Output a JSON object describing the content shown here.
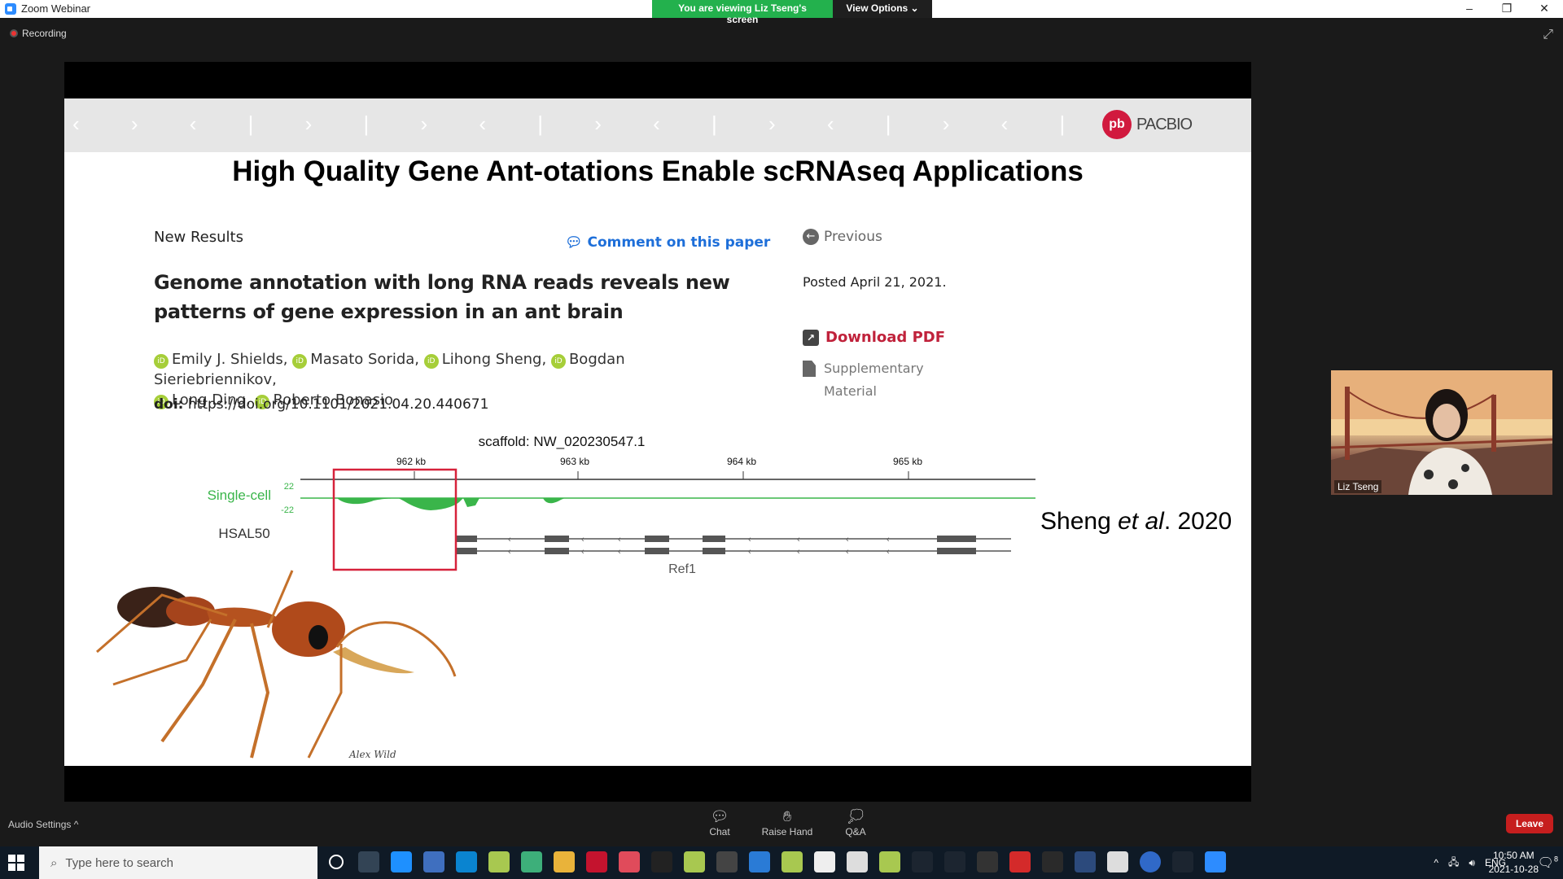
{
  "window": {
    "title": "Zoom Webinar",
    "minimize": "–",
    "restore": "❐",
    "close": "✕"
  },
  "banner": {
    "viewing": "You are viewing Liz Tseng's screen",
    "view_options": "View Options ⌄"
  },
  "recording": {
    "label": "Recording"
  },
  "slide": {
    "brand": "PACBIO",
    "brand_mark": "pb",
    "title": "High Quality Gene Ant-otations Enable scRNAseq Applications",
    "section": "New Results",
    "comment": "Comment on this paper",
    "previous": "Previous",
    "paper_title": "Genome annotation with long RNA reads reveals new patterns of gene expression in an ant brain",
    "posted": "Posted April 21, 2021.",
    "download": "Download PDF",
    "supplementary": "Supplementary Material",
    "authors": [
      "Emily J. Shields,",
      "Masato Sorida,",
      "Lihong Sheng,",
      "Bogdan Sieriebriennikov,",
      "Long Ding,",
      "Roberto Bonasio"
    ],
    "orcid_mark": "iD",
    "doi_label": "doi:",
    "doi_value": "https://doi.org/10.1101/2021.04.20.440671",
    "figure": {
      "scaffold": "scaffold: NW_020230547.1",
      "ticks": [
        "962 kb",
        "963 kb",
        "964 kb",
        "965 kb"
      ],
      "track1": "Single-cell",
      "track1_top": "22",
      "track1_bottom": "-22",
      "track2": "HSAL50",
      "gene": "Ref1"
    },
    "citation_author": "Sheng ",
    "citation_etal": "et al",
    "citation_year": ". 2020",
    "signature": "Alex Wild"
  },
  "video": {
    "name": "Liz Tseng"
  },
  "controls": {
    "audio_settings": "Audio Settings ^",
    "chat": "Chat",
    "raise_hand": "Raise Hand",
    "qa": "Q&A",
    "leave": "Leave"
  },
  "taskbar": {
    "search_placeholder": "Type here to search",
    "language": "ENG",
    "time": "10:50 AM",
    "date": "2021-10-28",
    "notification_count": "8"
  },
  "colors": {
    "green_banner": "#23b14d",
    "leave": "#c61e1e",
    "pacbio_red": "#d1193e",
    "link_blue": "#1e6fd9",
    "download_red": "#c0223b",
    "track_green": "#3ab54a",
    "highlight_box": "#d6223b"
  }
}
